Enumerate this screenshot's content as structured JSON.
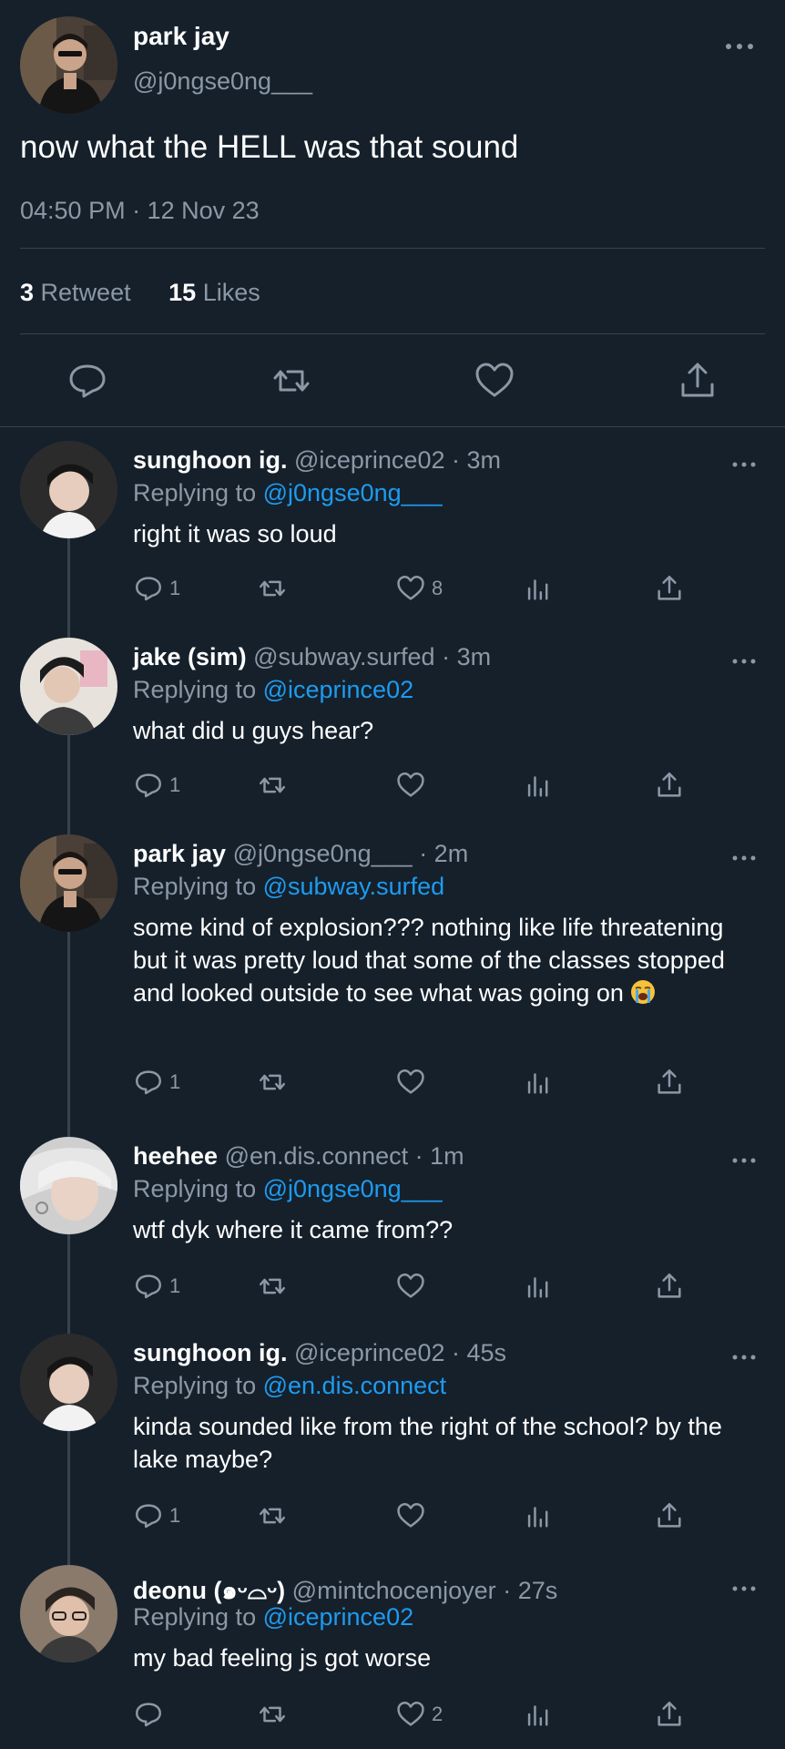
{
  "main_tweet": {
    "name": "park jay",
    "handle": "@j0ngse0ng___",
    "text": "now what the HELL was that sound",
    "time": "04:50 PM · 12 Nov 23",
    "retweet_count": "3",
    "retweet_label": "Retweet",
    "like_count": "15",
    "like_label": "Likes"
  },
  "replying_label": "Replying to",
  "replies": [
    {
      "name": "sunghoon ig.",
      "handle": "@iceprince02",
      "time": "· 3m",
      "replying_to": "@j0ngse0ng___",
      "text": "right it was so loud",
      "reply_count": "1",
      "like_count": "8"
    },
    {
      "name": "jake (sim)",
      "handle": "@subway.surfed",
      "time": "· 3m",
      "replying_to": "@iceprince02",
      "text": "what did u guys hear?",
      "reply_count": "1",
      "like_count": ""
    },
    {
      "name": "park jay",
      "handle": "@j0ngse0ng___",
      "time": "· 2m",
      "replying_to": "@subway.surfed",
      "text": "some kind of explosion??? nothing like life threatening but it was pretty loud that some of the classes stopped and looked outside to see what was going on",
      "emoji": "loudly-crying-face",
      "reply_count": "1",
      "like_count": ""
    },
    {
      "name": "heehee",
      "handle": "@en.dis.connect",
      "time": "· 1m",
      "replying_to": "@j0ngse0ng___",
      "text": "wtf dyk where it came from??",
      "reply_count": "1",
      "like_count": ""
    },
    {
      "name": "sunghoon ig.",
      "handle": "@iceprince02",
      "time": "· 45s",
      "replying_to": "@en.dis.connect",
      "text": "kinda sounded like from the right of the school? by the lake maybe?",
      "reply_count": "1",
      "like_count": ""
    },
    {
      "name": "deonu (๑ᵕ⌓ᵕ)",
      "handle": "@mintchocenjoyer",
      "time": "· 27s",
      "replying_to": "@iceprince02",
      "text": "my bad feeling js got worse",
      "reply_count": "",
      "like_count": "2"
    }
  ],
  "colors": {
    "background": "#15202b",
    "text": "#ffffff",
    "muted": "#8b98a5",
    "link": "#1d9bf0",
    "divider": "#38444d"
  }
}
